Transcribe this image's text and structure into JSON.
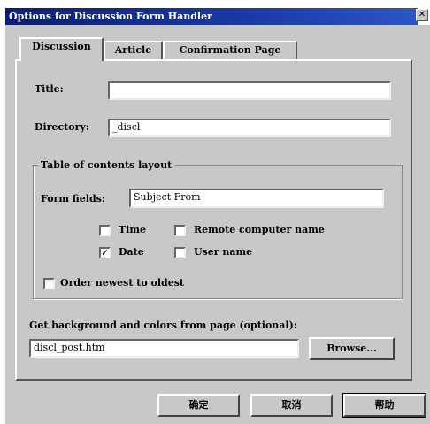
{
  "window": {
    "title": "Options for Discussion Form Handler",
    "close_glyph": "✕"
  },
  "tabs": [
    {
      "label": "Discussion",
      "active": true
    },
    {
      "label": "Article",
      "active": false
    },
    {
      "label": "Confirmation Page",
      "active": false
    }
  ],
  "form": {
    "title_label": "Title:",
    "title_value": "",
    "directory_label": "Directory:",
    "directory_value": "_discl"
  },
  "toc": {
    "group_label": "Table of contents layout",
    "form_fields_label": "Form fields:",
    "form_fields_value": "Subject From",
    "time_label": "Time",
    "time_checked": false,
    "date_label": "Date",
    "date_checked": true,
    "remote_label": "Remote computer name",
    "remote_checked": false,
    "user_label": "User name",
    "user_checked": false,
    "order_label": "Order newest to oldest",
    "order_checked": false
  },
  "background": {
    "label": "Get background and colors from page (optional):",
    "value": "discl_post.htm",
    "browse_label": "Browse..."
  },
  "footer": {
    "ok_label": "确定",
    "cancel_label": "取消",
    "help_label": "帮助"
  }
}
